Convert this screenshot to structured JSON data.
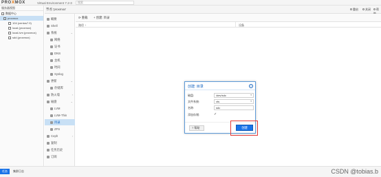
{
  "app": {
    "logo_pre": "PRO",
    "logo_x": "X",
    "logo_post": "MOX",
    "version": "Virtual Environment 7.2-3",
    "search_placeholder": "搜索"
  },
  "tree": {
    "view": "服务器视图",
    "items": [
      {
        "label": "数据中心"
      },
      {
        "label": "proxmox"
      },
      {
        "label": "104 (centos7.9)"
      },
      {
        "label": "local (proxmox)"
      },
      {
        "label": "local-lvm (proxmox)"
      },
      {
        "label": "sdd (proxmox)"
      }
    ]
  },
  "header": {
    "title": "节点 'proxmox'",
    "reboot": "重启",
    "shutdown": "关闭",
    "help": "帮助"
  },
  "menu": {
    "items": [
      {
        "label": "概要"
      },
      {
        "label": "Shell"
      },
      {
        "label": "系统"
      },
      {
        "label": "网络"
      },
      {
        "label": "证书"
      },
      {
        "label": "DNS"
      },
      {
        "label": "主机"
      },
      {
        "label": "时间"
      },
      {
        "label": "Syslog"
      },
      {
        "label": "更新"
      },
      {
        "label": "存储库"
      },
      {
        "label": "防火墙"
      },
      {
        "label": "磁盘"
      },
      {
        "label": "LVM"
      },
      {
        "label": "LVM-Thin"
      },
      {
        "label": "目录"
      },
      {
        "label": "ZFS"
      },
      {
        "label": "Ceph"
      },
      {
        "label": "复制"
      },
      {
        "label": "任务历史"
      },
      {
        "label": "订阅"
      }
    ]
  },
  "toolbar": {
    "reload": "重载",
    "create": "创建: 目录"
  },
  "grid": {
    "columns": [
      "路径 ↑",
      "设备"
    ]
  },
  "dialog": {
    "title": "创建: 目录",
    "disk_label": "磁盘:",
    "disk_value": "/dev/sdc",
    "fs_label": "文件系统:",
    "fs_value": "xfs",
    "name_label": "名称:",
    "name_value": "sdc",
    "add_storage_label": "添加存储:",
    "add_storage_check": "✓",
    "help_label": "帮助",
    "create_label": "创建"
  },
  "bottom": {
    "tab_tasks": "任务",
    "tab_cluster_log": "集群日志",
    "watermark": "CSDN @tobias.b"
  },
  "colors": {
    "accent": "#1a73e8",
    "highlight": "#e53935"
  }
}
